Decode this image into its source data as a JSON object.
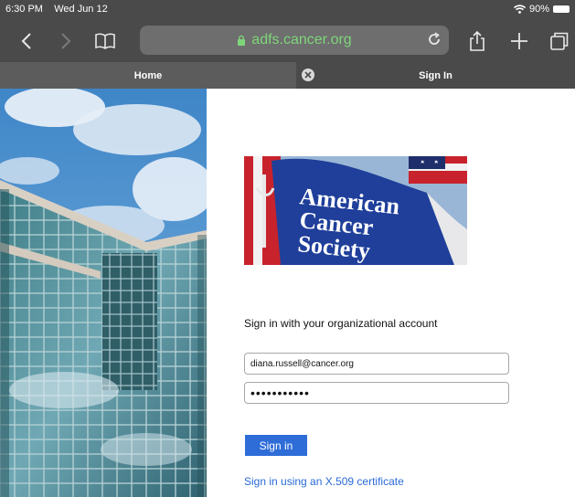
{
  "status_bar": {
    "time": "6:30 PM",
    "date": "Wed Jun 12",
    "battery": "90%"
  },
  "toolbar": {
    "url": "adfs.cancer.org"
  },
  "tabs": [
    {
      "label": "Home"
    },
    {
      "label": "Sign In"
    }
  ],
  "logo": {
    "line1": "American",
    "line2": "Cancer",
    "line3": "Society"
  },
  "login": {
    "heading": "Sign in with your organizational account",
    "email_value": "diana.russell@cancer.org",
    "password_value": "•••••••••••",
    "signin_label": "Sign in",
    "cert_link": "Sign in using an X.509 certificate"
  },
  "colors": {
    "url_green": "#7ed67a",
    "button_blue": "#2e6dd8",
    "link_blue": "#2a6ad8",
    "chrome_gray": "#4a4a4a"
  }
}
